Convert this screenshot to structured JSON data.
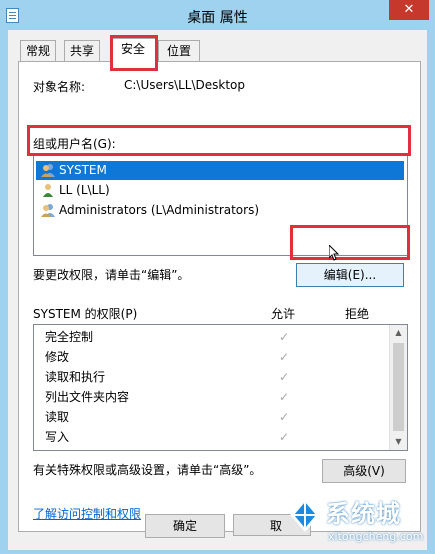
{
  "window": {
    "title": "桌面 属性",
    "close_glyph": "✕"
  },
  "tabs": [
    {
      "label": "常规",
      "active": false
    },
    {
      "label": "共享",
      "active": false
    },
    {
      "label": "安全",
      "active": true
    },
    {
      "label": "位置",
      "active": false
    }
  ],
  "object": {
    "label": "对象名称:",
    "value": "C:\\Users\\LL\\Desktop"
  },
  "groups": {
    "label": "组或用户名(G):",
    "items": [
      {
        "name": "SYSTEM",
        "icon": "users-group-icon",
        "selected": true
      },
      {
        "name": "LL (L\\LL)",
        "icon": "user-icon",
        "selected": false
      },
      {
        "name": "Administrators (L\\Administrators)",
        "icon": "users-group-icon",
        "selected": false
      }
    ]
  },
  "edit_hint": "要更改权限，请单击“编辑”。",
  "edit_button": "编辑(E)...",
  "permissions": {
    "label": "SYSTEM 的权限(P)",
    "allow_header": "允许",
    "deny_header": "拒绝",
    "check_glyph": "✓",
    "rows": [
      {
        "name": "完全控制",
        "allow": true,
        "deny": false
      },
      {
        "name": "修改",
        "allow": true,
        "deny": false
      },
      {
        "name": "读取和执行",
        "allow": true,
        "deny": false
      },
      {
        "name": "列出文件夹内容",
        "allow": true,
        "deny": false
      },
      {
        "name": "读取",
        "allow": true,
        "deny": false
      },
      {
        "name": "写入",
        "allow": true,
        "deny": false
      }
    ]
  },
  "advanced_hint": "有关特殊权限或高级设置，请单击“高级”。",
  "advanced_button": "高级(V)",
  "learn_link": "了解访问控制和权限",
  "footer": {
    "ok": "确定",
    "cancel_partial": "取"
  },
  "watermark": {
    "name": "系统城",
    "url": "xitongcheng.com"
  },
  "colors": {
    "selection": "#0f78d7",
    "highlight_box": "#e0303b",
    "close": "#c7382c",
    "link": "#0066cc"
  }
}
